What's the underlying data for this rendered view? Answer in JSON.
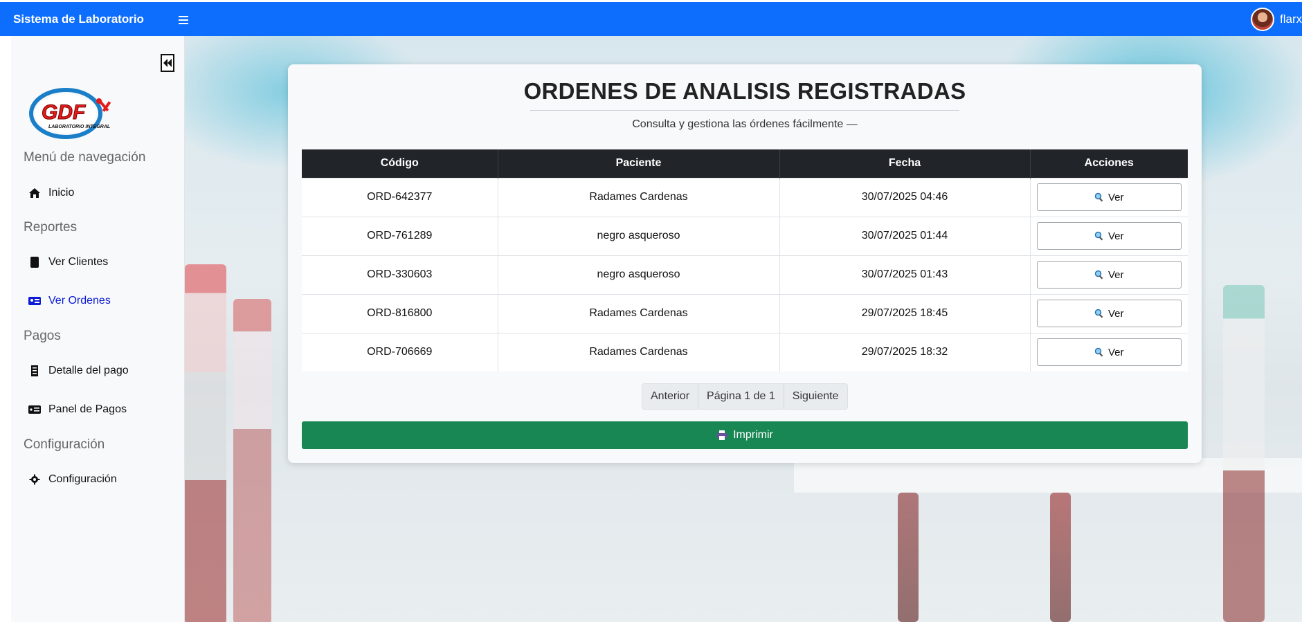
{
  "navbar": {
    "brand": "Sistema de Laboratorio",
    "username": "flarxx",
    "color": "#0d6efd"
  },
  "sidebar": {
    "logo_text": "GDF",
    "logo_subtitle": "LABORATORIO INTEGRAL",
    "sections": {
      "nav": "Menú de navegación",
      "reportes": "Reportes",
      "pagos": "Pagos",
      "config": "Configuración"
    },
    "items": [
      {
        "label": "Inicio",
        "icon": "home-icon"
      },
      {
        "label": "Ver Clientes",
        "icon": "tablet-icon"
      },
      {
        "label": "Ver Ordenes",
        "icon": "id-card-icon",
        "active": true
      },
      {
        "label": "Detalle del pago",
        "icon": "receipt-icon"
      },
      {
        "label": "Panel de Pagos",
        "icon": "money-icon"
      },
      {
        "label": "Configuración",
        "icon": "gear-icon"
      }
    ]
  },
  "main": {
    "title": "ORDENES DE ANALISIS REGISTRADAS",
    "subtitle": "Consulta y gestiona las órdenes fácilmente —",
    "table": {
      "headers": [
        "Código",
        "Paciente",
        "Fecha",
        "Acciones"
      ],
      "rows": [
        {
          "code": "ORD-642377",
          "patient": "Radames Cardenas",
          "date": "30/07/2025 04:46",
          "action": "Ver"
        },
        {
          "code": "ORD-761289",
          "patient": "negro asqueroso",
          "date": "30/07/2025 01:44",
          "action": "Ver"
        },
        {
          "code": "ORD-330603",
          "patient": "negro asqueroso",
          "date": "30/07/2025 01:43",
          "action": "Ver"
        },
        {
          "code": "ORD-816800",
          "patient": "Radames Cardenas",
          "date": "29/07/2025 18:45",
          "action": "Ver"
        },
        {
          "code": "ORD-706669",
          "patient": "Radames Cardenas",
          "date": "29/07/2025 18:32",
          "action": "Ver"
        }
      ]
    },
    "pagination": {
      "prev": "Anterior",
      "page_info": "Página 1 de 1",
      "next": "Siguiente"
    },
    "print_label": "Imprimir",
    "print_color": "#198754"
  }
}
